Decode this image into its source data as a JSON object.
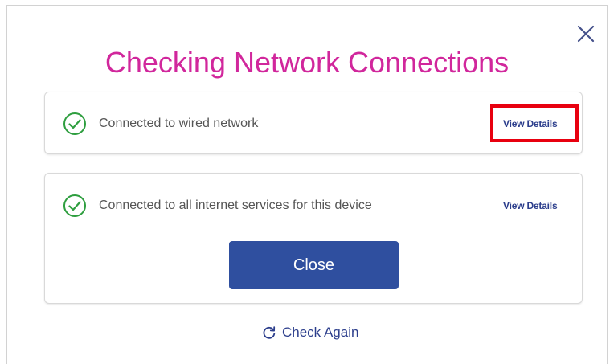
{
  "dialog": {
    "title": "Checking Network Connections",
    "close_icon": "close-icon"
  },
  "checks": [
    {
      "status_icon": "check-circle-icon",
      "text": "Connected to wired network",
      "details_label": "View Details"
    },
    {
      "status_icon": "check-circle-icon",
      "text": "Connected to all internet services for this device",
      "details_label": "View Details"
    }
  ],
  "actions": {
    "close_label": "Close",
    "check_again_label": "Check Again",
    "check_again_icon": "refresh-icon"
  },
  "colors": {
    "title": "#d1279c",
    "success": "#2e9e3f",
    "link": "#2c3e8c",
    "primary_button": "#2f4f9f",
    "highlight": "#e8000f"
  }
}
